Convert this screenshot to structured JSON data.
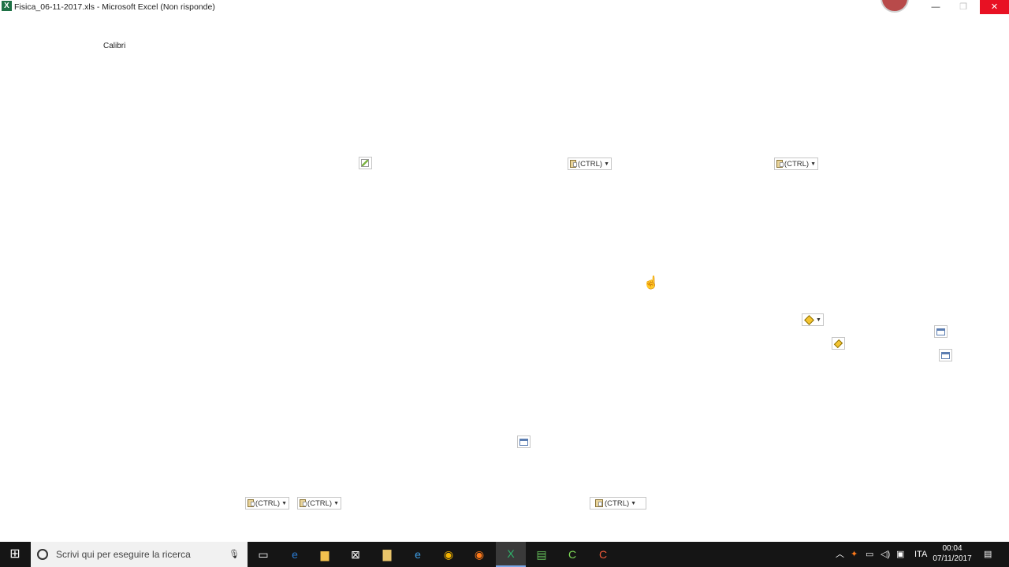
{
  "window": {
    "app_icon": "X",
    "title": "Fisica_06-11-2017.xls - Microsoft Excel (Non risponde)",
    "minimize_glyph": "—",
    "restore_glyph": "❐",
    "close_glyph": "✕"
  },
  "ribbon": {
    "font_name": "Calibri"
  },
  "paste_options_label": "(CTRL)",
  "taskbar": {
    "search_placeholder": "Scrivi qui per eseguire la ricerca",
    "language": "ITA",
    "time": "00:04",
    "date": "07/11/2017"
  },
  "icons": {
    "start": "windows-icon",
    "task_view": "task-view-icon",
    "edge": "edge-icon",
    "explorer": "file-explorer-icon",
    "store": "store-icon",
    "ie": "internet-explorer-icon",
    "chrome": "chrome-icon",
    "firefox": "firefox-icon",
    "excel": "excel-icon"
  },
  "colors": {
    "excel_green": "#1e7145",
    "close_red": "#e81123",
    "taskbar": "#151515"
  }
}
